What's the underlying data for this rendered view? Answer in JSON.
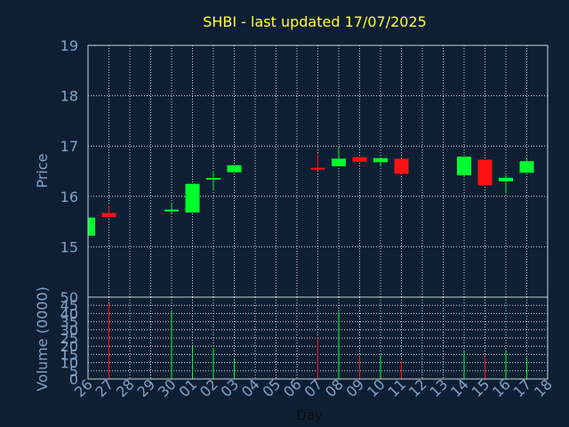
{
  "chart_data": {
    "type": "candlestick",
    "title": "SHBI - last updated 17/07/2025",
    "xlabel": "Day",
    "price_axis": {
      "label": "Price",
      "ylim": [
        14,
        19
      ],
      "ticks": [
        "15",
        "16",
        "17",
        "18",
        "19"
      ]
    },
    "volume_axis": {
      "label": "Volume (0000)",
      "ylim": [
        0,
        50
      ],
      "ticks": [
        "0",
        "5",
        "10",
        "15",
        "20",
        "25",
        "30",
        "35",
        "40",
        "45",
        "50"
      ]
    },
    "x_ticks": [
      "26",
      "27",
      "28",
      "29",
      "30",
      "01",
      "02",
      "03",
      "04",
      "05",
      "06",
      "07",
      "08",
      "09",
      "10",
      "11",
      "12",
      "13",
      "14",
      "15",
      "16",
      "17",
      "18"
    ],
    "grid": true,
    "colors": {
      "up": "#00ff2e",
      "down": "#ff1111",
      "background": "#0f1f33",
      "text": "#7fa3c8",
      "title": "#ffff33",
      "grid": "#c9d3de"
    },
    "candles": [
      {
        "day": "26",
        "open": 15.22,
        "high": 15.58,
        "low": 15.22,
        "close": 15.58,
        "volume": 0
      },
      {
        "day": "27",
        "open": 15.67,
        "high": 15.83,
        "low": 15.59,
        "close": 15.59,
        "volume": 46
      },
      {
        "day": "30",
        "open": 15.7,
        "high": 15.87,
        "low": 15.65,
        "close": 15.72,
        "volume": 41
      },
      {
        "day": "01",
        "open": 15.68,
        "high": 16.25,
        "low": 15.68,
        "close": 16.25,
        "volume": 20
      },
      {
        "day": "02",
        "open": 16.35,
        "high": 16.48,
        "low": 16.14,
        "close": 16.35,
        "volume": 19
      },
      {
        "day": "03",
        "open": 16.48,
        "high": 16.62,
        "low": 16.48,
        "close": 16.62,
        "volume": 12
      },
      {
        "day": "07",
        "open": 16.55,
        "high": 16.86,
        "low": 16.5,
        "close": 16.54,
        "volume": 25
      },
      {
        "day": "08",
        "open": 16.6,
        "high": 16.97,
        "low": 16.6,
        "close": 16.75,
        "volume": 41
      },
      {
        "day": "09",
        "open": 16.78,
        "high": 16.79,
        "low": 16.69,
        "close": 16.69,
        "volume": 15
      },
      {
        "day": "10",
        "open": 16.68,
        "high": 16.78,
        "low": 16.59,
        "close": 16.76,
        "volume": 15
      },
      {
        "day": "11",
        "open": 16.75,
        "high": 16.75,
        "low": 16.45,
        "close": 16.45,
        "volume": 11
      },
      {
        "day": "14",
        "open": 16.42,
        "high": 16.79,
        "low": 16.38,
        "close": 16.79,
        "volume": 17
      },
      {
        "day": "15",
        "open": 16.73,
        "high": 16.73,
        "low": 16.22,
        "close": 16.22,
        "volume": 13
      },
      {
        "day": "16",
        "open": 16.3,
        "high": 16.42,
        "low": 16.06,
        "close": 16.37,
        "volume": 17
      },
      {
        "day": "17",
        "open": 16.47,
        "high": 16.77,
        "low": 16.47,
        "close": 16.7,
        "volume": 13
      }
    ]
  }
}
